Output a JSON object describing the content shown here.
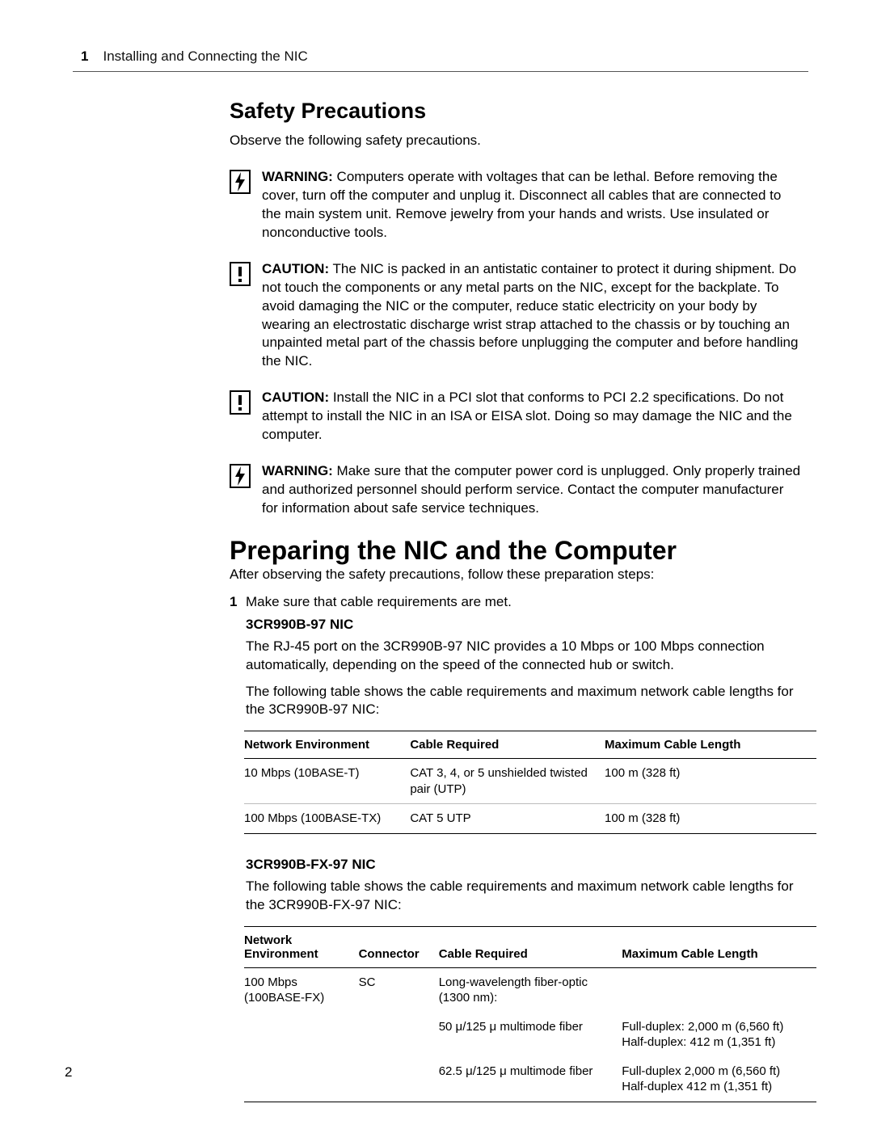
{
  "header": {
    "chapter_number": "1",
    "chapter_title": "Installing and Connecting the NIC"
  },
  "page_number": "2",
  "section1": {
    "title": "Safety Precautions",
    "intro": "Observe the following safety precautions.",
    "callouts": [
      {
        "type": "warning",
        "label": "WARNING:",
        "text": " Computers operate with voltages that can be lethal. Before removing the cover, turn off the computer and unplug it. Disconnect all cables that are connected to the main system unit. Remove jewelry from your hands and wrists. Use insulated or nonconductive tools."
      },
      {
        "type": "caution",
        "label": "CAUTION:",
        "text": " The NIC is packed in an antistatic container to protect it during shipment. Do not touch the components or any metal parts on the NIC, except for the backplate. To avoid damaging the NIC or the computer, reduce static electricity on your body by wearing an electrostatic discharge wrist strap attached to the chassis or by touching an unpainted metal part of the chassis before unplugging the computer and before handling the NIC."
      },
      {
        "type": "caution",
        "label": "CAUTION:",
        "text": " Install the NIC in a PCI slot that conforms to PCI 2.2 specifications. Do not attempt to install the NIC in an ISA or EISA slot. Doing so may damage the NIC and the computer."
      },
      {
        "type": "warning",
        "label": "WARNING:",
        "text": " Make sure that the computer power cord is unplugged. Only properly trained and authorized personnel should perform service. Contact the computer manufacturer for information about safe service techniques."
      }
    ]
  },
  "section2": {
    "title": "Preparing the NIC and the Computer",
    "intro": "After observing the safety precautions, follow these preparation steps:",
    "step1_num": "1",
    "step1_text": "Make sure that cable requirements are met.",
    "nic_a": {
      "heading": "3CR990B-97 NIC",
      "p1": "The RJ-45 port on the 3CR990B-97 NIC provides a 10 Mbps or 100 Mbps connection automatically, depending on the speed of the connected hub or switch.",
      "p2": "The following table shows the cable requirements and maximum network cable lengths for the 3CR990B-97 NIC:",
      "table": {
        "headers": [
          "Network Environment",
          "Cable Required",
          "Maximum Cable Length"
        ],
        "rows": [
          [
            "10 Mbps (10BASE-T)",
            "CAT 3, 4, or 5 unshielded twisted pair (UTP)",
            "100 m (328 ft)"
          ],
          [
            "100 Mbps (100BASE-TX)",
            "CAT 5 UTP",
            "100 m (328 ft)"
          ]
        ]
      }
    },
    "nic_b": {
      "heading": "3CR990B-FX-97 NIC",
      "p1": "The following table shows the cable requirements and maximum network cable lengths for the 3CR990B-FX-97 NIC:",
      "table": {
        "headers": [
          "Network Environment",
          "Connector",
          "Cable Required",
          "Maximum Cable Length"
        ],
        "rows": [
          {
            "env": "100 Mbps (100BASE-FX)",
            "conn": "SC",
            "cable": "Long-wavelength fiber-optic (1300 nm):",
            "max": ""
          },
          {
            "env": "",
            "conn": "",
            "cable": "50 μ/125 μ multimode fiber",
            "max": "Full-duplex: 2,000 m (6,560 ft)\nHalf-duplex: 412 m (1,351 ft)"
          },
          {
            "env": "",
            "conn": "",
            "cable": "62.5 μ/125 μ multimode fiber",
            "max": "Full-duplex 2,000 m (6,560 ft)\nHalf-duplex 412 m (1,351 ft)"
          }
        ]
      }
    }
  }
}
